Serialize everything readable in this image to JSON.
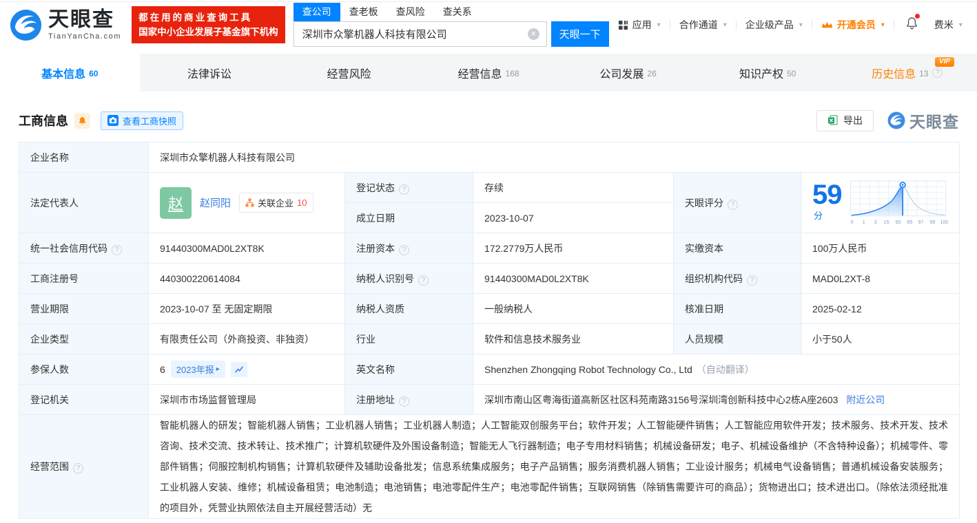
{
  "colors": {
    "accent": "#0084ff",
    "vip_orange": "#ff8000",
    "status_green": "#00a862",
    "banner_red": "#e8230d",
    "score_blue": "#1273eb",
    "link_blue": "#3a7dde"
  },
  "header": {
    "brand": "天眼查",
    "brand_domain": "TianYanCha.com",
    "slogan_line1": "都在用的商业查询工具",
    "slogan_line2": "国家中小企业发展子基金旗下机构",
    "search": {
      "tabs": [
        "查公司",
        "查老板",
        "查风险",
        "查关系"
      ],
      "value": "深圳市众擎机器人科技有限公司",
      "button": "天眼一下"
    },
    "nav": {
      "apps": "应用",
      "partner": "合作通道",
      "enterprise": "企业级产品",
      "vip": "开通会员",
      "user": "费米"
    }
  },
  "tabs": [
    {
      "label": "基本信息",
      "count": "60"
    },
    {
      "label": "法律诉讼",
      "count": ""
    },
    {
      "label": "经营风险",
      "count": ""
    },
    {
      "label": "经营信息",
      "count": "168"
    },
    {
      "label": "公司发展",
      "count": "26"
    },
    {
      "label": "知识产权",
      "count": "50"
    },
    {
      "label": "历史信息",
      "count": "13",
      "vip_badge": "VIP"
    }
  ],
  "section": {
    "title": "工商信息",
    "snapshot_button": "查看工商快照",
    "export_button": "导出",
    "watermark_brand": "天眼查"
  },
  "biz": {
    "company_name": {
      "label": "企业名称",
      "value": "深圳市众擎机器人科技有限公司"
    },
    "legal_rep": {
      "label": "法定代表人",
      "avatar_char": "赵",
      "name": "赵同阳",
      "related_label": "关联企业",
      "related_count": "10"
    },
    "reg_status": {
      "label": "登记状态",
      "value": "存续"
    },
    "establish_date": {
      "label": "成立日期",
      "value": "2023-10-07"
    },
    "tianyan_score": {
      "label": "天眼评分",
      "score": "59",
      "unit": "分",
      "axis": [
        "0",
        "1",
        "3",
        "15",
        "50",
        "85",
        "97",
        "99",
        "100"
      ]
    },
    "credit_code": {
      "label": "统一社会信用代码",
      "value": "91440300MAD0L2XT8K"
    },
    "reg_capital": {
      "label": "注册资本",
      "value": "172.2779万人民币"
    },
    "paid_capital": {
      "label": "实缴资本",
      "value": "100万人民币"
    },
    "reg_number": {
      "label": "工商注册号",
      "value": "440300220614084"
    },
    "taxpayer_id": {
      "label": "纳税人识别号",
      "value": "91440300MAD0L2XT8K"
    },
    "org_code": {
      "label": "组织机构代码",
      "value": "MAD0L2XT-8"
    },
    "business_term": {
      "label": "营业期限",
      "value": "2023-10-07 至 无固定期限"
    },
    "taxpayer_quality": {
      "label": "纳税人资质",
      "value": "一般纳税人"
    },
    "approval_date": {
      "label": "核准日期",
      "value": "2025-02-12"
    },
    "company_type": {
      "label": "企业类型",
      "value": "有限责任公司（外商投资、非独资）"
    },
    "industry": {
      "label": "行业",
      "value": "软件和信息技术服务业"
    },
    "staff_size": {
      "label": "人员规模",
      "value": "小于50人"
    },
    "insured_count": {
      "label": "参保人数",
      "value": "6",
      "report_badge": "2023年报"
    },
    "english_name": {
      "label": "英文名称",
      "value": "Shenzhen Zhongqing Robot Technology Co., Ltd",
      "note": "（自动翻译）"
    },
    "reg_authority": {
      "label": "登记机关",
      "value": "深圳市市场监督管理局"
    },
    "reg_address": {
      "label": "注册地址",
      "value": "深圳市南山区粤海街道高新区社区科苑南路3156号深圳湾创新科技中心2栋A座2603",
      "nearby_link": "附近公司"
    },
    "business_scope": {
      "label": "经营范围",
      "value": "智能机器人的研发；智能机器人销售；工业机器人销售；工业机器人制造；人工智能双创服务平台；软件开发；人工智能硬件销售；人工智能应用软件开发；技术服务、技术开发、技术咨询、技术交流、技术转让、技术推广；计算机软硬件及外围设备制造；智能无人飞行器制造；电子专用材料销售；机械设备研发；电子、机械设备维护（不含特种设备）；机械零件、零部件销售；伺服控制机构销售；计算机软硬件及辅助设备批发；信息系统集成服务；电子产品销售；服务消费机器人销售；工业设计服务；机械电气设备销售；普通机械设备安装服务；工业机器人安装、维修；机械设备租赁；电池制造；电池销售；电池零配件生产；电池零配件销售；互联网销售（除销售需要许可的商品）；货物进出口；技术进出口。（除依法须经批准的项目外，凭营业执照依法自主开展经营活动）无"
    }
  }
}
